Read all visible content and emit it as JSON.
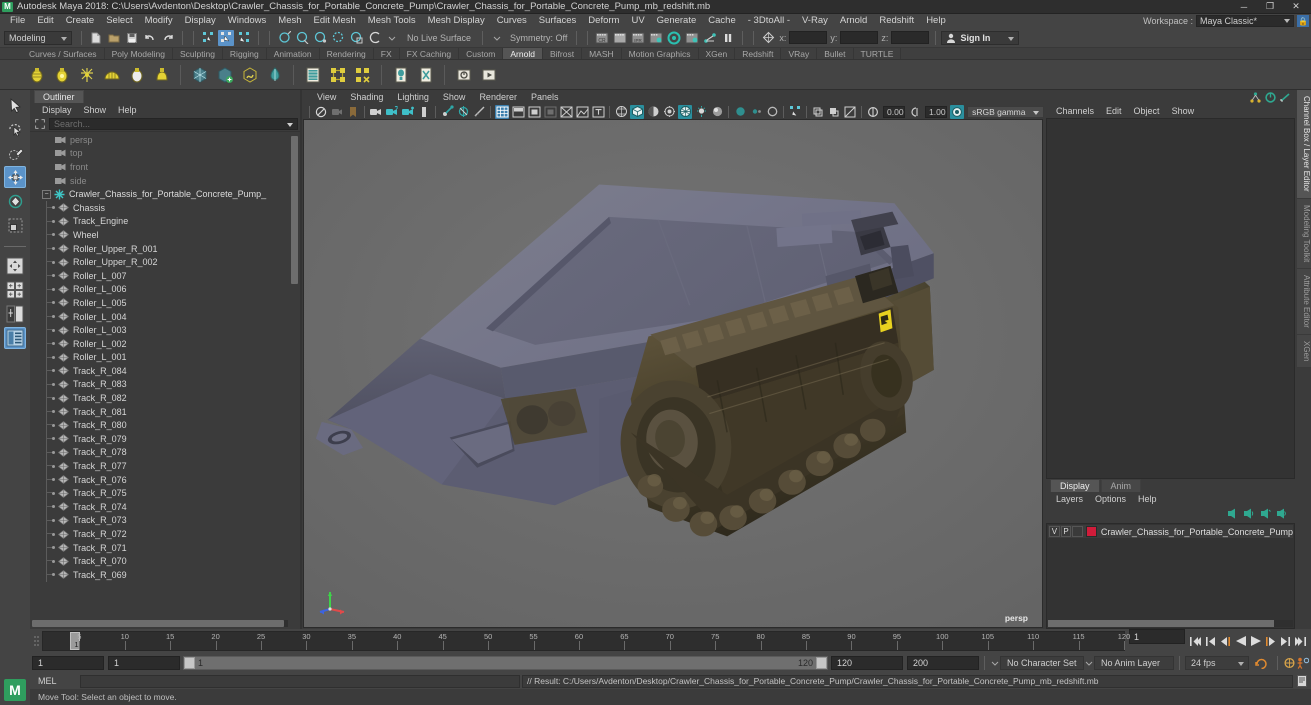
{
  "titlebar": {
    "logo": "maya-logo",
    "title": "Autodesk Maya 2018: C:\\Users\\Avdenton\\Desktop\\Crawler_Chassis_for_Portable_Concrete_Pump\\Crawler_Chassis_for_Portable_Concrete_Pump_mb_redshift.mb",
    "minimize": "─",
    "maximize": "❐",
    "close": "✕"
  },
  "menubar": {
    "items": [
      "File",
      "Edit",
      "Create",
      "Select",
      "Modify",
      "Display",
      "Windows",
      "Mesh",
      "Edit Mesh",
      "Mesh Tools",
      "Mesh Display",
      "Curves",
      "Surfaces",
      "Deform",
      "UV",
      "Generate",
      "Cache",
      "- 3DtoAll -",
      "V-Ray",
      "Arnold",
      "Redshift",
      "Help"
    ],
    "workspace_label": "Workspace :",
    "workspace_value": "Maya Classic*"
  },
  "statusline": {
    "mode": "Modeling",
    "no_live_surface": "No Live Surface",
    "symmetry": "Symmetry: Off",
    "coord_x_label": "x:",
    "coord_y_label": "y:",
    "coord_z_label": "z:",
    "coord_x": "",
    "coord_y": "",
    "coord_z": "",
    "signin": "Sign In"
  },
  "shelf": {
    "tabs": [
      "Curves / Surfaces",
      "Poly Modeling",
      "Sculpting",
      "Rigging",
      "Animation",
      "Rendering",
      "FX",
      "FX Caching",
      "Custom",
      "Arnold",
      "Bifrost",
      "MASH",
      "Motion Graphics",
      "XGen",
      "Redshift",
      "VRay",
      "Bullet",
      "TURTLE"
    ],
    "active_tab": "Arnold"
  },
  "toolbox": {
    "items": [
      {
        "name": "select-tool",
        "label": "Select Tool"
      },
      {
        "name": "lasso-select-tool",
        "label": "Lasso Select Tool"
      },
      {
        "name": "paint-select-tool",
        "label": "Paint Select Tool"
      },
      {
        "name": "move-tool",
        "label": "Move Tool"
      },
      {
        "name": "rotate-tool",
        "label": "Rotate Tool"
      },
      {
        "name": "scale-tool",
        "label": "Scale Tool"
      }
    ],
    "layout_items": [
      {
        "name": "single-perspective-layout",
        "label": "Single Perspective View"
      },
      {
        "name": "four-view-layout",
        "label": "Four View Layout"
      },
      {
        "name": "persp-outliner-layout",
        "label": "Persp/Outliner Layout"
      },
      {
        "name": "hypershade-layout",
        "label": "Hypershade Layout"
      }
    ]
  },
  "outliner": {
    "tab": "Outliner",
    "menu": [
      "Display",
      "Show",
      "Help"
    ],
    "search_placeholder": "Search...",
    "items": [
      {
        "label": "persp",
        "type": "camera",
        "dim": true,
        "depth": 1
      },
      {
        "label": "top",
        "type": "camera",
        "dim": true,
        "depth": 1
      },
      {
        "label": "front",
        "type": "camera",
        "dim": true,
        "depth": 1
      },
      {
        "label": "side",
        "type": "camera",
        "dim": true,
        "depth": 1
      },
      {
        "label": "Crawler_Chassis_for_Portable_Concrete_Pump_",
        "type": "group",
        "dim": false,
        "depth": 0
      },
      {
        "label": "Chassis",
        "type": "mesh",
        "dim": false,
        "depth": 1
      },
      {
        "label": "Track_Engine",
        "type": "mesh",
        "dim": false,
        "depth": 1
      },
      {
        "label": "Wheel",
        "type": "mesh",
        "dim": false,
        "depth": 1
      },
      {
        "label": "Roller_Upper_R_001",
        "type": "mesh",
        "dim": false,
        "depth": 1
      },
      {
        "label": "Roller_Upper_R_002",
        "type": "mesh",
        "dim": false,
        "depth": 1
      },
      {
        "label": "Roller_L_007",
        "type": "mesh",
        "dim": false,
        "depth": 1
      },
      {
        "label": "Roller_L_006",
        "type": "mesh",
        "dim": false,
        "depth": 1
      },
      {
        "label": "Roller_L_005",
        "type": "mesh",
        "dim": false,
        "depth": 1
      },
      {
        "label": "Roller_L_004",
        "type": "mesh",
        "dim": false,
        "depth": 1
      },
      {
        "label": "Roller_L_003",
        "type": "mesh",
        "dim": false,
        "depth": 1
      },
      {
        "label": "Roller_L_002",
        "type": "mesh",
        "dim": false,
        "depth": 1
      },
      {
        "label": "Roller_L_001",
        "type": "mesh",
        "dim": false,
        "depth": 1
      },
      {
        "label": "Track_R_084",
        "type": "mesh",
        "dim": false,
        "depth": 1
      },
      {
        "label": "Track_R_083",
        "type": "mesh",
        "dim": false,
        "depth": 1
      },
      {
        "label": "Track_R_082",
        "type": "mesh",
        "dim": false,
        "depth": 1
      },
      {
        "label": "Track_R_081",
        "type": "mesh",
        "dim": false,
        "depth": 1
      },
      {
        "label": "Track_R_080",
        "type": "mesh",
        "dim": false,
        "depth": 1
      },
      {
        "label": "Track_R_079",
        "type": "mesh",
        "dim": false,
        "depth": 1
      },
      {
        "label": "Track_R_078",
        "type": "mesh",
        "dim": false,
        "depth": 1
      },
      {
        "label": "Track_R_077",
        "type": "mesh",
        "dim": false,
        "depth": 1
      },
      {
        "label": "Track_R_076",
        "type": "mesh",
        "dim": false,
        "depth": 1
      },
      {
        "label": "Track_R_075",
        "type": "mesh",
        "dim": false,
        "depth": 1
      },
      {
        "label": "Track_R_074",
        "type": "mesh",
        "dim": false,
        "depth": 1
      },
      {
        "label": "Track_R_073",
        "type": "mesh",
        "dim": false,
        "depth": 1
      },
      {
        "label": "Track_R_072",
        "type": "mesh",
        "dim": false,
        "depth": 1
      },
      {
        "label": "Track_R_071",
        "type": "mesh",
        "dim": false,
        "depth": 1
      },
      {
        "label": "Track_R_070",
        "type": "mesh",
        "dim": false,
        "depth": 1
      },
      {
        "label": "Track_R_069",
        "type": "mesh",
        "dim": false,
        "depth": 1
      }
    ]
  },
  "viewport": {
    "menu": [
      "View",
      "Shading",
      "Lighting",
      "Show",
      "Renderer",
      "Panels"
    ],
    "exposure": "0.00",
    "gamma": "1.00",
    "color_space": "sRGB gamma",
    "camera_label": "persp"
  },
  "channelbox": {
    "menu": [
      "Channels",
      "Edit",
      "Object",
      "Show"
    ],
    "vtabs": [
      "Channel Box / Layer Editor",
      "Modeling Toolkit",
      "Attribute Editor",
      "XGen"
    ],
    "active_vtab": "Channel Box / Layer Editor"
  },
  "layereditor": {
    "tabs": [
      "Display",
      "Anim"
    ],
    "active_tab": "Display",
    "menu": [
      "Layers",
      "Options",
      "Help"
    ],
    "layers": [
      {
        "v": "V",
        "p": "P",
        "color": "#d01c3a",
        "name": "Crawler_Chassis_for_Portable_Concrete_Pump"
      }
    ]
  },
  "timeslider": {
    "ticks": [
      5,
      10,
      15,
      20,
      25,
      30,
      35,
      40,
      45,
      50,
      55,
      60,
      65,
      70,
      75,
      80,
      85,
      90,
      95,
      100,
      105,
      110,
      115,
      120
    ],
    "range_start": 1,
    "range_end": 120,
    "current_frame": "1",
    "current_field": "1"
  },
  "rangeslider": {
    "anim_start": "1",
    "range_start": "1",
    "bar_lo": "1",
    "bar_hi": "120",
    "range_end": "120",
    "anim_end": "200",
    "character_set": "No Character Set",
    "anim_layer": "No Anim Layer",
    "fps": "24 fps"
  },
  "cmdline": {
    "mel_label": "MEL",
    "mel_input": "",
    "result": "// Result: C:/Users/Avdenton/Desktop/Crawler_Chassis_for_Portable_Concrete_Pump/Crawler_Chassis_for_Portable_Concrete_Pump_mb_redshift.mb"
  },
  "helpline": {
    "text": "Move Tool: Select an object to move."
  }
}
